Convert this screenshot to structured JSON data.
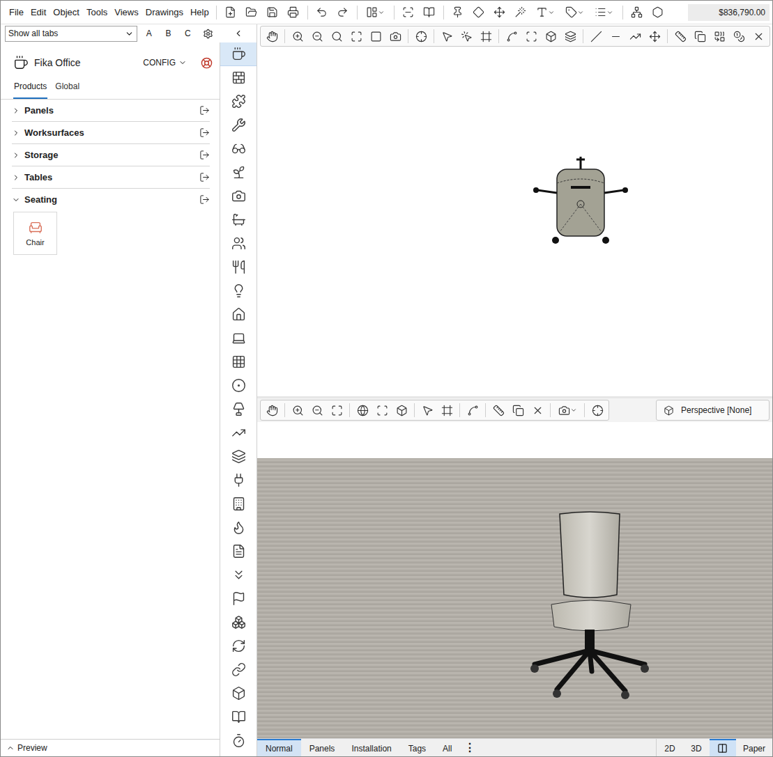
{
  "menu": [
    "File",
    "Edit",
    "Object",
    "Tools",
    "Views",
    "Drawings",
    "Help"
  ],
  "price": "$836,790.00",
  "filter": {
    "value": "Show all tabs",
    "letters": [
      "A",
      "B",
      "C"
    ]
  },
  "catalog": {
    "name": "Fika Office",
    "config": "CONFIG"
  },
  "tabs": [
    {
      "label": "Products",
      "selected": true
    },
    {
      "label": "Global",
      "selected": false
    }
  ],
  "sections": [
    {
      "label": "Panels",
      "expanded": false,
      "items": []
    },
    {
      "label": "Worksurfaces",
      "expanded": false,
      "items": []
    },
    {
      "label": "Storage",
      "expanded": false,
      "items": []
    },
    {
      "label": "Tables",
      "expanded": false,
      "items": []
    },
    {
      "label": "Seating",
      "expanded": true,
      "items": [
        {
          "label": "Chair"
        }
      ]
    }
  ],
  "preview": {
    "label": "Preview",
    "expanded": false
  },
  "tools": [
    {
      "selected": true
    },
    {
      "selected": false
    },
    {
      "selected": false
    },
    {
      "selected": false
    },
    {
      "selected": false
    },
    {
      "selected": false
    },
    {
      "selected": false
    },
    {
      "selected": false
    },
    {
      "selected": false
    },
    {
      "selected": false
    },
    {
      "selected": false
    },
    {
      "selected": false
    },
    {
      "selected": false
    },
    {
      "selected": false
    },
    {
      "selected": false
    },
    {
      "selected": false
    },
    {
      "selected": false
    },
    {
      "selected": false
    },
    {
      "selected": false
    },
    {
      "selected": false
    },
    {
      "selected": false
    },
    {
      "selected": false
    },
    {
      "selected": false
    },
    {
      "selected": false
    },
    {
      "selected": false
    },
    {
      "selected": false
    },
    {
      "selected": false
    },
    {
      "selected": false
    },
    {
      "selected": false
    },
    {
      "selected": false
    }
  ],
  "camera": "Perspective [None]",
  "view_tabs": [
    {
      "label": "Normal",
      "selected": true
    },
    {
      "label": "Panels",
      "selected": false
    },
    {
      "label": "Installation",
      "selected": false
    },
    {
      "label": "Tags",
      "selected": false
    },
    {
      "label": "All",
      "selected": false
    }
  ],
  "more": "⋮",
  "modes": [
    {
      "kind": "text",
      "label": "2D",
      "selected": false
    },
    {
      "kind": "text",
      "label": "3D",
      "selected": false
    },
    {
      "kind": "icon",
      "selected": true
    },
    {
      "kind": "text",
      "label": "Paper",
      "selected": false
    }
  ]
}
